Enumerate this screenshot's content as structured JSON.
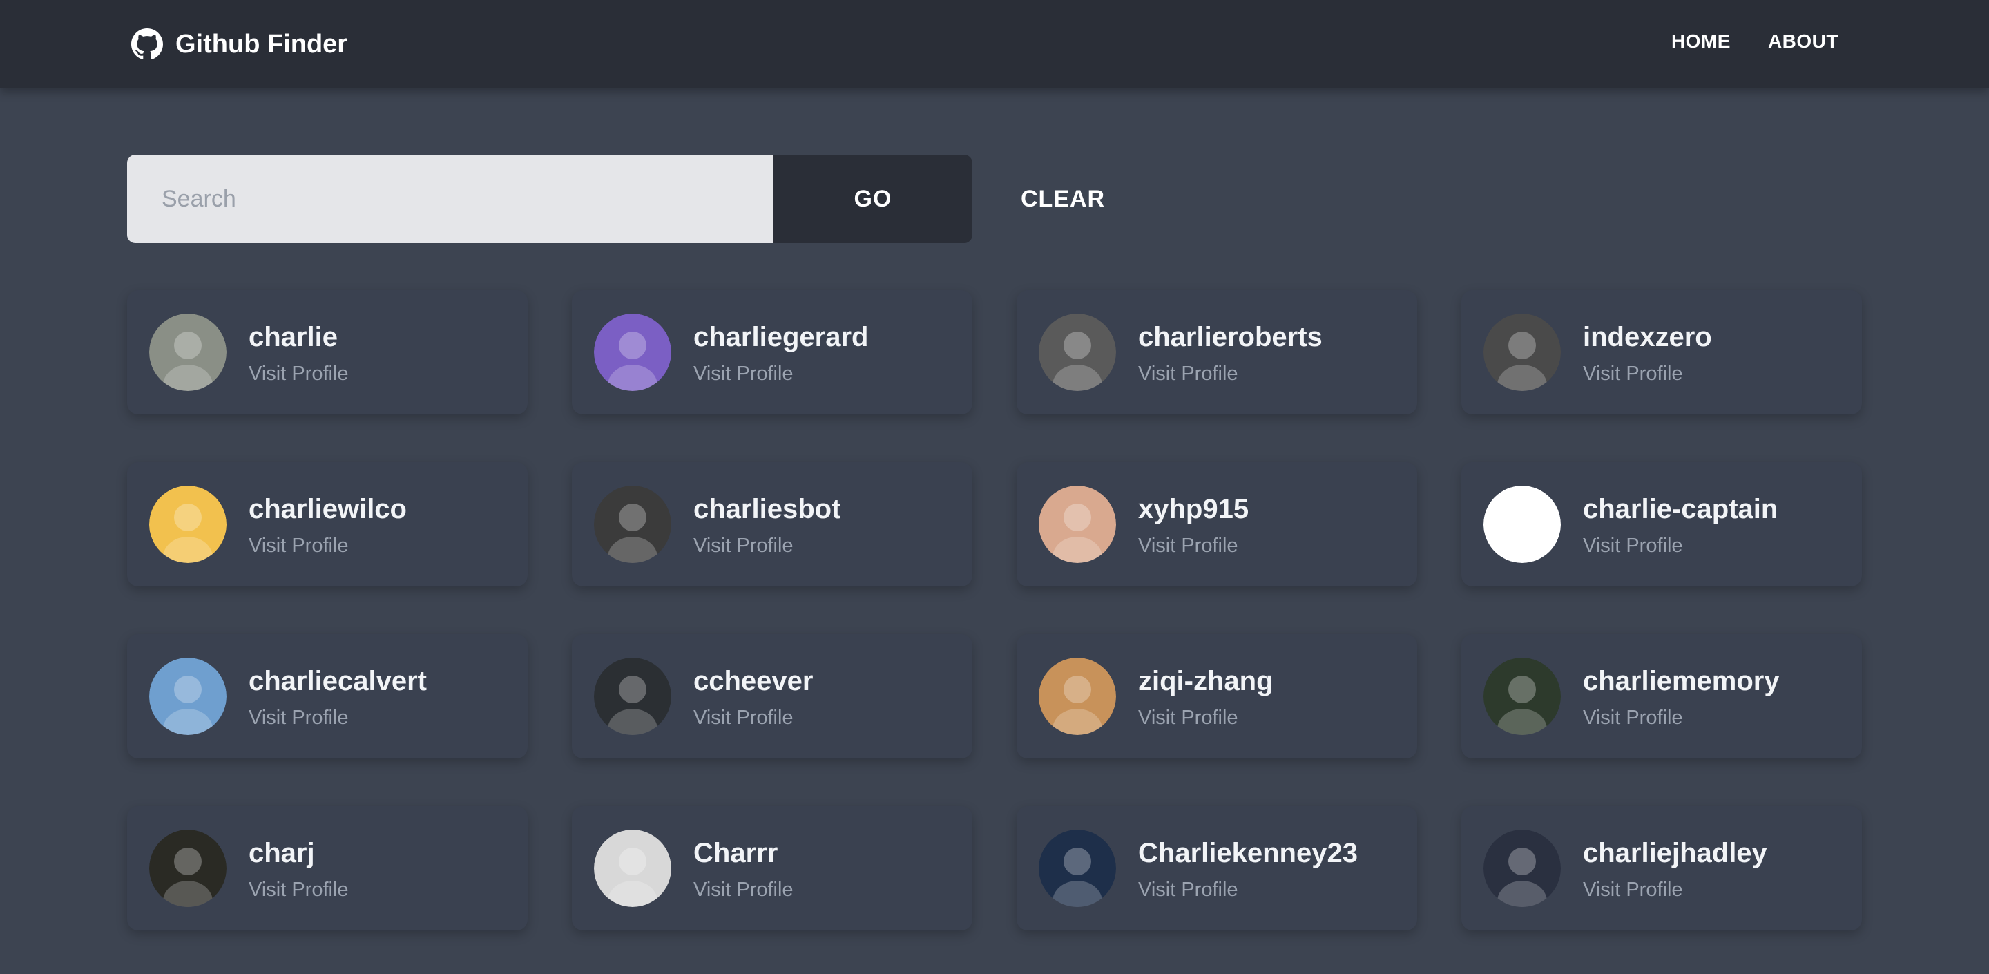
{
  "navbar": {
    "brand": "Github Finder",
    "brand_icon": "github-icon",
    "links": [
      {
        "label": "HOME"
      },
      {
        "label": "ABOUT"
      }
    ]
  },
  "search": {
    "placeholder": "Search",
    "value": "",
    "go_label": "GO",
    "clear_label": "CLEAR"
  },
  "users": [
    {
      "login": "charlie",
      "link": "Visit Profile",
      "avatar_color": "#8a8f86"
    },
    {
      "login": "charliegerard",
      "link": "Visit Profile",
      "avatar_color": "#7b5fc4"
    },
    {
      "login": "charlieroberts",
      "link": "Visit Profile",
      "avatar_color": "#5a5a5a"
    },
    {
      "login": "indexzero",
      "link": "Visit Profile",
      "avatar_color": "#4a4a4a"
    },
    {
      "login": "charliewilco",
      "link": "Visit Profile",
      "avatar_color": "#f2c14e"
    },
    {
      "login": "charliesbot",
      "link": "Visit Profile",
      "avatar_color": "#3b3b3b"
    },
    {
      "login": "xyhp915",
      "link": "Visit Profile",
      "avatar_color": "#d9a98f"
    },
    {
      "login": "charlie-captain",
      "link": "Visit Profile",
      "avatar_color": "#ffffff"
    },
    {
      "login": "charliecalvert",
      "link": "Visit Profile",
      "avatar_color": "#6f9fcf"
    },
    {
      "login": "ccheever",
      "link": "Visit Profile",
      "avatar_color": "#2b2f33"
    },
    {
      "login": "ziqi-zhang",
      "link": "Visit Profile",
      "avatar_color": "#c8925a"
    },
    {
      "login": "charliememory",
      "link": "Visit Profile",
      "avatar_color": "#2d3a2c"
    },
    {
      "login": "charj",
      "link": "Visit Profile",
      "avatar_color": "#2a2a24"
    },
    {
      "login": "Charrr",
      "link": "Visit Profile",
      "avatar_color": "#d8d8d8"
    },
    {
      "login": "Charliekenney23",
      "link": "Visit Profile",
      "avatar_color": "#1e2f4a"
    },
    {
      "login": "charliejhadley",
      "link": "Visit Profile",
      "avatar_color": "#2a3040"
    }
  ]
}
